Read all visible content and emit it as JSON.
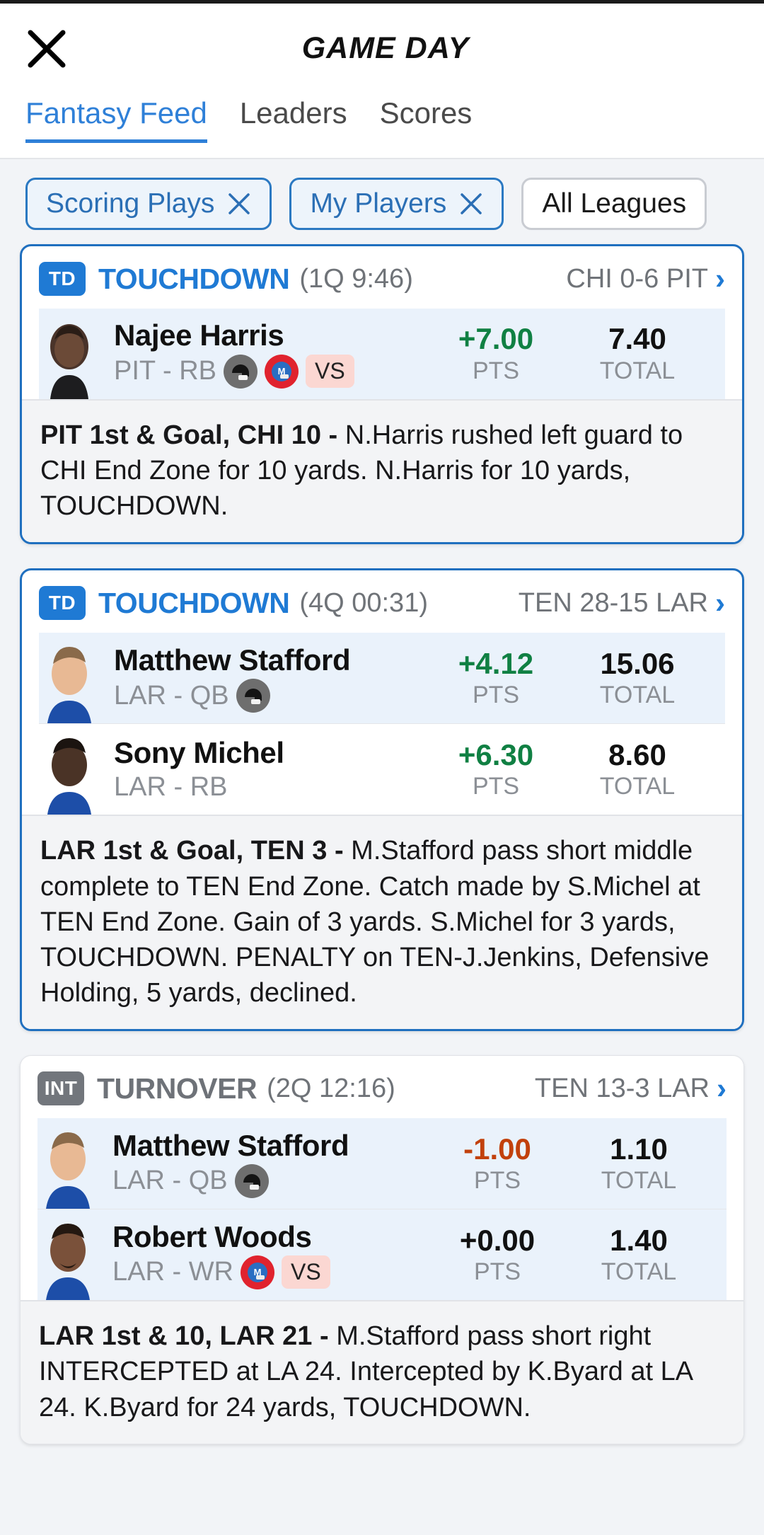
{
  "navbar": {
    "close_icon": "close-icon",
    "title": "GAME DAY"
  },
  "tabs": [
    {
      "label": "Fantasy Feed",
      "active": true
    },
    {
      "label": "Leaders",
      "active": false
    },
    {
      "label": "Scores",
      "active": false
    }
  ],
  "filters": [
    {
      "label": "Scoring Plays",
      "removable": true,
      "selected": true
    },
    {
      "label": "My Players",
      "removable": true,
      "selected": true
    },
    {
      "label": "All Leagues",
      "removable": false,
      "selected": false
    }
  ],
  "feed": [
    {
      "badge": "TD",
      "type_label": "TOUCHDOWN",
      "time": "(1Q 9:46)",
      "score": "CHI 0-6 PIT",
      "highlight": true,
      "players": [
        {
          "name": "Najee Harris",
          "team_pos": "PIT - RB",
          "icons": [
            "helmet-dark-icon",
            "helmet-red-icon"
          ],
          "vs": "VS",
          "pts": "+7.00",
          "pts_sign": "pos",
          "pts_label": "PTS",
          "total": "7.40",
          "total_label": "TOTAL",
          "highlight": true
        }
      ],
      "desc_bold": "PIT 1st & Goal, CHI 10 -",
      "desc_text": " N.Harris rushed left guard to CHI End Zone for 10 yards. N.Harris for 10 yards, TOUCHDOWN."
    },
    {
      "badge": "TD",
      "type_label": "TOUCHDOWN",
      "time": "(4Q 00:31)",
      "score": "TEN 28-15 LAR",
      "highlight": true,
      "players": [
        {
          "name": "Matthew Stafford",
          "team_pos": "LAR - QB",
          "icons": [
            "helmet-dark-icon"
          ],
          "vs": "",
          "pts": "+4.12",
          "pts_sign": "pos",
          "pts_label": "PTS",
          "total": "15.06",
          "total_label": "TOTAL",
          "highlight": true
        },
        {
          "name": "Sony Michel",
          "team_pos": "LAR - RB",
          "icons": [],
          "vs": "",
          "pts": "+6.30",
          "pts_sign": "pos",
          "pts_label": "PTS",
          "total": "8.60",
          "total_label": "TOTAL",
          "highlight": false
        }
      ],
      "desc_bold": "LAR 1st & Goal, TEN 3 -",
      "desc_text": " M.Stafford pass short middle complete to TEN End Zone. Catch made by S.Michel at TEN End Zone. Gain of 3 yards. S.Michel for 3 yards, TOUCHDOWN. PENALTY on TEN-J.Jenkins, Defensive Holding, 5 yards, declined."
    },
    {
      "badge": "INT",
      "type_label": "TURNOVER",
      "time": "(2Q 12:16)",
      "score": "TEN 13-3 LAR",
      "highlight": false,
      "players": [
        {
          "name": "Matthew Stafford",
          "team_pos": "LAR - QB",
          "icons": [
            "helmet-dark-icon"
          ],
          "vs": "",
          "pts": "-1.00",
          "pts_sign": "neg",
          "pts_label": "PTS",
          "total": "1.10",
          "total_label": "TOTAL",
          "highlight": true
        },
        {
          "name": "Robert Woods",
          "team_pos": "LAR - WR",
          "icons": [
            "helmet-red-icon"
          ],
          "vs": "VS",
          "pts": "+0.00",
          "pts_sign": "dark",
          "pts_label": "PTS",
          "total": "1.40",
          "total_label": "TOTAL",
          "highlight": true
        }
      ],
      "desc_bold": "LAR 1st & 10, LAR 21 -",
      "desc_text": " M.Stafford pass short right INTERCEPTED at LA 24. Intercepted by K.Byard at LA 24. K.Byard for 24 yards, TOUCHDOWN."
    }
  ],
  "colors": {
    "accent": "#1f7ad4",
    "positive": "#108043",
    "negative": "#c2410c",
    "neutral_badge": "#72767c",
    "page_bg": "#f2f4f7"
  }
}
